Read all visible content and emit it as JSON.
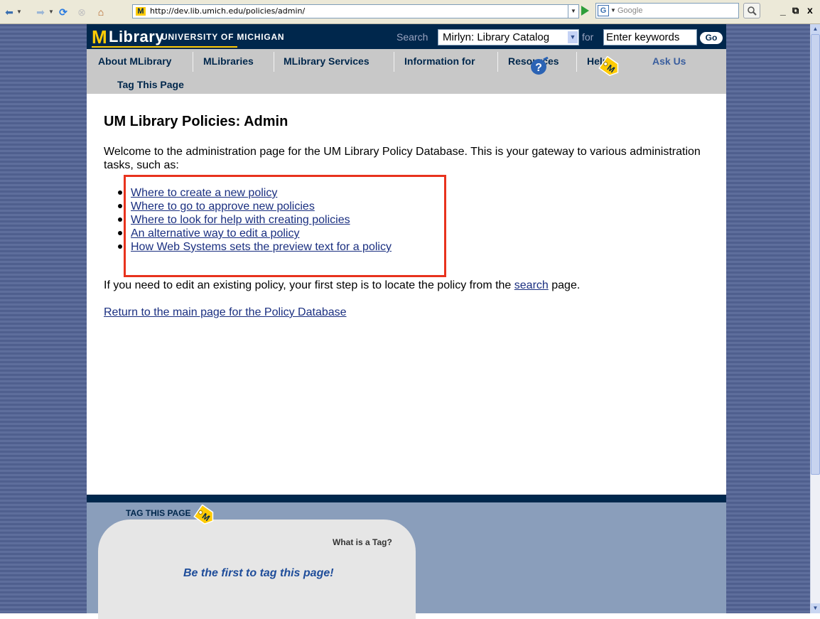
{
  "browser": {
    "url": "http://dev.lib.umich.edu/policies/admin/",
    "search_engine_label": "G",
    "search_placeholder": "Google",
    "window_controls": {
      "minimize": "_",
      "restore": "Ɖ",
      "close": "x"
    }
  },
  "site_header": {
    "logo_m": "M",
    "logo_library": "Library",
    "university": "UNIVERSITY OF MICHIGAN",
    "search_label": "Search",
    "scope_value": "Mirlyn: Library Catalog",
    "for_label": "for",
    "keywords_placeholder": "Enter keywords",
    "go_label": "Go",
    "colors": {
      "brand_blue": "#00274c",
      "maize": "#ffcb05"
    }
  },
  "nav": {
    "items": [
      {
        "label": "About MLibrary"
      },
      {
        "label": "MLibraries"
      },
      {
        "label": "MLibrary Services"
      },
      {
        "label": "Information for"
      },
      {
        "label": "Resources"
      },
      {
        "label": "Help"
      },
      {
        "label": "Ask Us"
      }
    ],
    "tag_this_page": "Tag This Page",
    "icons": [
      "help-question-icon",
      "m-tag-icon"
    ]
  },
  "main": {
    "title": "UM Library Policies: Admin",
    "intro": "Welcome to the administration page for the UM Library Policy Database. This is your gateway to various administration tasks, such as:",
    "tasks": [
      {
        "label": "Where to create a new policy"
      },
      {
        "label": "Where to go to approve new policies"
      },
      {
        "label": "Where to look for help with creating policies"
      },
      {
        "label": "An alternative way to edit a policy"
      },
      {
        "label": "How Web Systems sets the preview text for a policy"
      }
    ],
    "edit_note_before": "If you need to edit an existing policy, your first step is to locate the policy from the ",
    "edit_note_link": "search",
    "edit_note_after": " page.",
    "return_link": "Return to the main page for the Policy Database",
    "highlight_color": "#e8321d"
  },
  "footer": {
    "tag_label": "TAG THIS PAGE",
    "what_is_tag": "What is a Tag?",
    "first_tag": "Be the first to tag this page!"
  }
}
